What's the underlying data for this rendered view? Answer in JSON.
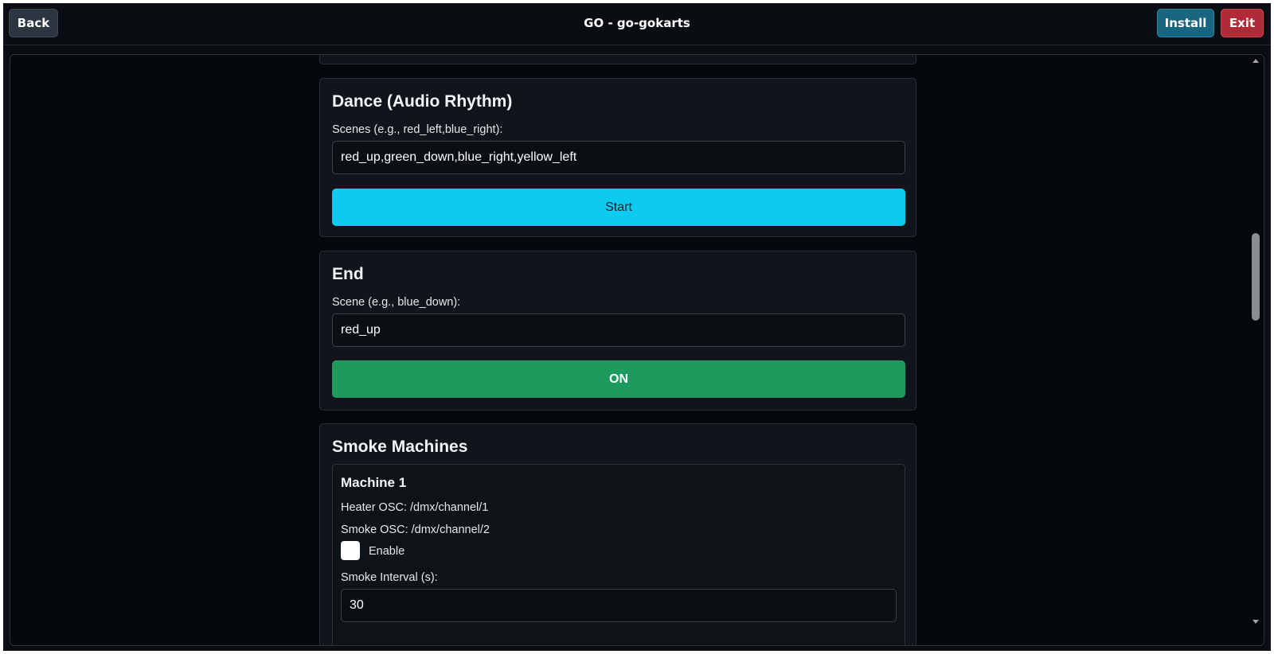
{
  "header": {
    "back_label": "Back",
    "title": "GO - go-gokarts",
    "install_label": "Install",
    "exit_label": "Exit"
  },
  "dance": {
    "title": "Dance (Audio Rhythm)",
    "scenes_label": "Scenes (e.g., red_left,blue_right):",
    "scenes_value": "red_up,green_down,blue_right,yellow_left",
    "start_label": "Start"
  },
  "end": {
    "title": "End",
    "scene_label": "Scene (e.g., blue_down):",
    "scene_value": "red_up",
    "on_label": "ON"
  },
  "smoke": {
    "title": "Smoke Machines",
    "machine": {
      "name": "Machine 1",
      "heater_osc": "Heater OSC: /dmx/channel/1",
      "smoke_osc": "Smoke OSC: /dmx/channel/2",
      "enable_label": "Enable",
      "enabled": false,
      "interval_label": "Smoke Interval (s):",
      "interval_value": "30"
    }
  },
  "colors": {
    "start_button": "#0dcaf0",
    "on_button": "#1f9a5e",
    "install_button": "#17657f",
    "exit_button": "#b02a37"
  }
}
